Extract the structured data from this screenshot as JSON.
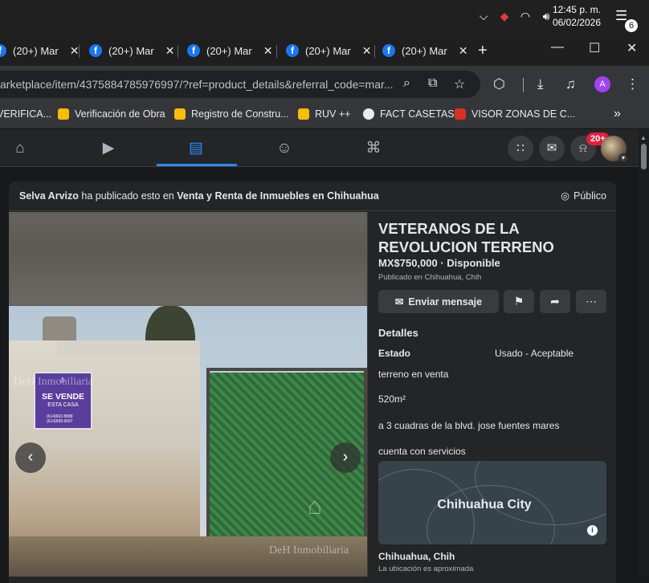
{
  "taskbar": {
    "time": "12:45 p. m.",
    "date": "06/02/2026",
    "notification_count": "6"
  },
  "tabs": [
    {
      "label": "(20+) Mar"
    },
    {
      "label": "(20+) Mar"
    },
    {
      "label": "(20+) Mar"
    },
    {
      "label": "(20+) Mar"
    },
    {
      "label": "(20+) Mar"
    }
  ],
  "address_bar": {
    "url": "arketplace/item/4375884785976997/?ref=product_details&referral_code=mar...",
    "profile_initial": "A"
  },
  "bookmarks": [
    {
      "label": "VERIFICA...",
      "color": "#d93025"
    },
    {
      "label": "Verificación de Obra",
      "color": "#fbbc04"
    },
    {
      "label": "Registro de Constru...",
      "color": "#fbbc04"
    },
    {
      "label": "RUV ++",
      "color": "#fbbc04"
    },
    {
      "label": "FACT CASETAS",
      "color": "#e8eaed"
    },
    {
      "label": "VISOR ZONAS DE C...",
      "color": "#d93025"
    }
  ],
  "fb_nav": {
    "notification_badge": "20+"
  },
  "post": {
    "author": "Selva Arvizo",
    "published_text": " ha publicado esto en ",
    "group": "Venta y Renta de Inmuebles en Chihuahua",
    "visibility": "Público"
  },
  "photo": {
    "sign_title": "SE VENDE",
    "sign_subtitle": "ESTA CASA",
    "sign_phone_1": "(614)663 8888",
    "sign_phone_2": "(614)599 6607",
    "watermark_1": "DeH Inmobiliaria",
    "watermark_2": "DeH Inmobiliaria"
  },
  "listing": {
    "title": "VETERANOS DE LA REVOLUCION TERRENO",
    "price": "MX$750,000 · Disponible",
    "published_in": "Publicado en Chihuahua, Chih",
    "message_button": "Enviar mensaje",
    "details_title": "Detalles",
    "estado_label": "Estado",
    "estado_value": "Usado - Aceptable",
    "description": [
      "terreno en venta",
      "520m²",
      "a 3 cuadras de la blvd. jose fuentes mares",
      "cuenta con servicios"
    ],
    "map_label": "Chihuahua City",
    "location": "Chihuahua, Chih",
    "location_note": "La ubicación es aproximada"
  }
}
